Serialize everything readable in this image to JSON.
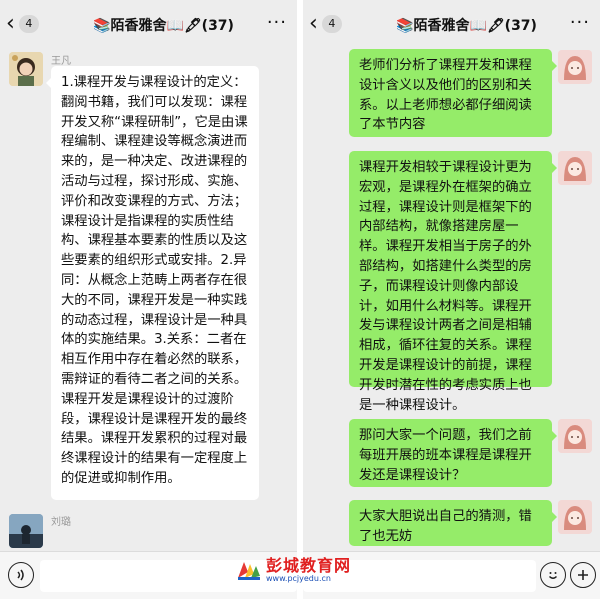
{
  "colors": {
    "bubble_green": "#95ec69",
    "bubble_white": "#ffffff",
    "background": "#ededed"
  },
  "left": {
    "nav": {
      "back_badge": "4",
      "title": "📚陌香雅舍📖🖋(37)",
      "more_icon": "more-dots-icon"
    },
    "messages": [
      {
        "sender": "王凡",
        "text": "1.课程开发与课程设计的定义：翻阅书籍，我们可以发现：课程开发又称“课程研制”，它是由课程编制、课程建设等概念演进而来的，是一种决定、改进课程的活动与过程，探讨形成、实施、评价和改变课程的方式、方法；课程设计是指课程的实质性结构、课程基本要素的性质以及这些要素的组织形式或安排。2.异同：从概念上范畴上两者存在很大的不同，课程开发是一种实践的动态过程，课程设计是一种具体的实施结果。3.关系：二者在相互作用中存在着必然的联系，需辩证的看待二者之间的关系。课程开发是课程设计的过渡阶段，课程设计是课程开发的最终结果。课程开发累积的过程对最终课程设计的结果有一定程度上的促进或抑制作用。"
      },
      {
        "sender": "刘璐",
        "text": ""
      }
    ]
  },
  "right": {
    "nav": {
      "back_badge": "4",
      "title": "📚陌香雅舍📖🖋(37)",
      "more_icon": "more-dots-icon"
    },
    "messages": [
      {
        "text": "老师们分析了课程开发和课程设计含义以及他们的区别和关系。以上老师想必都仔细阅读了本节内容"
      },
      {
        "text": "课程开发相较于课程设计更为宏观，是课程外在框架的确立过程，课程设计则是框架下的内部结构，就像搭建房屋一样。课程开发相当于房子的外部结构，如搭建什么类型的房子，而课程设计则像内部设计，如用什么材料等。课程开发与课程设计两者之间是相辅相成，循环往复的关系。课程开发是课程设计的前提，课程开发时潜在性的考虑实质上也是一种课程设计。"
      },
      {
        "text": "那问大家一个问题，我们之前每班开展的班本课程是课程开发还是课程设计？"
      },
      {
        "text": "大家大胆说出自己的猜测，错了也无妨"
      }
    ]
  },
  "input_bar": {
    "voice_icon": "voice-icon",
    "emoji_icon": "emoji-icon",
    "plus_icon": "plus-icon"
  },
  "watermark": {
    "text": "彭城教育网",
    "url": "www.pcjyedu.cn"
  }
}
